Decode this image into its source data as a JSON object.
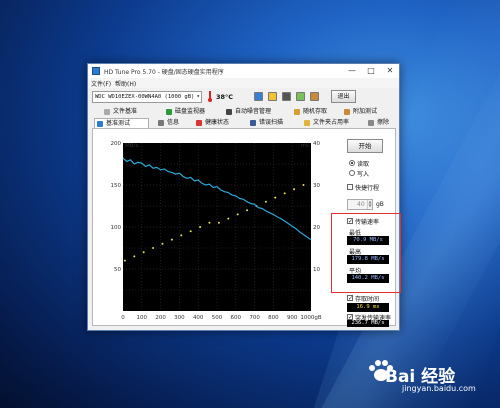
{
  "window": {
    "title": "HD Tune Pro 5.70 - 硬盘/固态硬盘实用程序",
    "controls": [
      "—",
      "□",
      "✕"
    ]
  },
  "menu": [
    "文件(F)",
    "帮助(H)"
  ],
  "toolbar": {
    "drive": "WDC WD10EZEX-00WN4A0 (1000 gB)",
    "temperature": "38°C",
    "exit_label": "退出"
  },
  "tabs_top": [
    "文件基准",
    "磁盘监视器",
    "自动噪音管理",
    "随机存取",
    "附加测试"
  ],
  "tabs_bottom": [
    "基准测试",
    "信息",
    "健康状态",
    "错误扫描",
    "文件夹占用率",
    "擦除"
  ],
  "active_tab": "基准测试",
  "controls": {
    "start_label": "开始",
    "read_label": "读取",
    "write_label": "写入",
    "quick_test_label": "快捷行程",
    "quick_value": "40",
    "unit_gb": "gB",
    "transfer_rate_label": "传输速率",
    "min_label": "最低",
    "min_value": "70.9 MB/s",
    "max_label": "最高",
    "max_value": "179.8 MB/s",
    "avg_label": "平均",
    "avg_value": "140.2 MB/s",
    "access_time_label": "存取时间",
    "access_time_value": "16.9 ms",
    "burst_rate_label": "突发传输速率",
    "burst_rate_value": "236.7 MB/s"
  },
  "chart_data": {
    "type": "line",
    "left_axis_unit": "MB/s",
    "right_axis_unit": "ms",
    "left_ticks": [
      "200",
      "150",
      "100",
      "50"
    ],
    "right_ticks": [
      "40",
      "30",
      "20",
      "10"
    ],
    "bottom_ticks": [
      "0",
      "100",
      "200",
      "300",
      "400",
      "500",
      "600",
      "700",
      "800",
      "900",
      "1000gB"
    ],
    "ylim_left": [
      0,
      200
    ],
    "ylim_right": [
      0,
      40
    ],
    "xlim": [
      0,
      1000
    ],
    "series": [
      {
        "name": "传输速率",
        "color": "#2aa8d8",
        "x": [
          0,
          20,
          40,
          60,
          80,
          100,
          120,
          140,
          160,
          180,
          200,
          220,
          240,
          260,
          280,
          300,
          320,
          340,
          360,
          380,
          400,
          420,
          440,
          460,
          480,
          500,
          520,
          540,
          560,
          580,
          600,
          620,
          640,
          660,
          680,
          700,
          720,
          740,
          760,
          780,
          800,
          820,
          840,
          860,
          880,
          900,
          920,
          940,
          960,
          980,
          1000
        ],
        "y": [
          182,
          178,
          180,
          175,
          177,
          176,
          172,
          174,
          170,
          171,
          168,
          169,
          166,
          165,
          163,
          164,
          160,
          158,
          159,
          155,
          156,
          152,
          150,
          151,
          147,
          148,
          144,
          142,
          141,
          138,
          137,
          134,
          133,
          130,
          128,
          127,
          123,
          122,
          119,
          117,
          115,
          112,
          110,
          107,
          104,
          101,
          98,
          94,
          91,
          88,
          85
        ]
      },
      {
        "name": "存取时间",
        "color": "#e8e060",
        "x": [
          10,
          60,
          110,
          160,
          210,
          260,
          310,
          360,
          410,
          460,
          510,
          560,
          610,
          660,
          710,
          760,
          810,
          860,
          910,
          960
        ],
        "y": [
          12,
          13,
          14,
          15,
          16,
          17,
          18,
          19,
          20,
          21,
          21,
          22,
          23,
          24,
          25,
          26,
          27,
          28,
          29,
          30
        ]
      }
    ]
  },
  "watermark": {
    "text": "Bai 经验",
    "url": "jingyan.baidu.com"
  }
}
